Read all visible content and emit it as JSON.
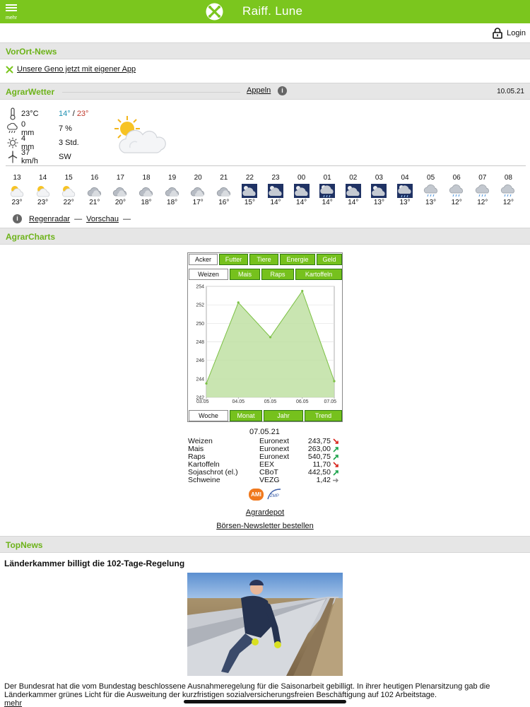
{
  "header": {
    "menu_label": "mehr",
    "app_title": "Raiff. Lune"
  },
  "login": {
    "label": "Login"
  },
  "sections": {
    "vorort": "VorOrt-News",
    "agrarwetter": "AgrarWetter",
    "agrarcharts": "AgrarCharts",
    "topnews": "TopNews"
  },
  "vorort_news": {
    "link": "Unsere Geno jetzt mit eigener App"
  },
  "weather": {
    "location": "Appeln",
    "date": "10.05.21",
    "temperature": "23°C",
    "min": "14°",
    "slash": " / ",
    "max": "23°",
    "precip_mm": "0 mm",
    "precip_pct": "7 %",
    "sun_mm": "4 mm",
    "sun_hours": "3 Std.",
    "wind_speed": "37 km/h",
    "wind_dir": "SW",
    "forecast": [
      {
        "hour": "13",
        "temp": "23°",
        "icon": "sun-cloud"
      },
      {
        "hour": "14",
        "temp": "23°",
        "icon": "sun-cloud"
      },
      {
        "hour": "15",
        "temp": "22°",
        "icon": "sun-cloud"
      },
      {
        "hour": "16",
        "temp": "21°",
        "icon": "cloud"
      },
      {
        "hour": "17",
        "temp": "20°",
        "icon": "cloud"
      },
      {
        "hour": "18",
        "temp": "18°",
        "icon": "cloud"
      },
      {
        "hour": "19",
        "temp": "18°",
        "icon": "cloud"
      },
      {
        "hour": "20",
        "temp": "17°",
        "icon": "cloud"
      },
      {
        "hour": "21",
        "temp": "16°",
        "icon": "cloud"
      },
      {
        "hour": "22",
        "temp": "15°",
        "icon": "night-cloud"
      },
      {
        "hour": "23",
        "temp": "14°",
        "icon": "night-cloud"
      },
      {
        "hour": "00",
        "temp": "14°",
        "icon": "night-cloud"
      },
      {
        "hour": "01",
        "temp": "14°",
        "icon": "night-rain"
      },
      {
        "hour": "02",
        "temp": "14°",
        "icon": "night-cloud"
      },
      {
        "hour": "03",
        "temp": "13°",
        "icon": "night-cloud"
      },
      {
        "hour": "04",
        "temp": "13°",
        "icon": "night-rain"
      },
      {
        "hour": "05",
        "temp": "13°",
        "icon": "cloud-rain"
      },
      {
        "hour": "06",
        "temp": "12°",
        "icon": "cloud-rain"
      },
      {
        "hour": "07",
        "temp": "12°",
        "icon": "cloud-rain"
      },
      {
        "hour": "08",
        "temp": "12°",
        "icon": "cloud-rain"
      }
    ],
    "links": {
      "radar": "Regenradar",
      "dash1": " — ",
      "preview": "Vorschau",
      "dash2": " —"
    }
  },
  "charts": {
    "tabs_top": [
      "Acker",
      "Futter",
      "Tiere",
      "Energie",
      "Geld"
    ],
    "tabs_sub": [
      "Weizen",
      "Mais",
      "Raps",
      "Kartoffeln"
    ],
    "tabs_range": [
      "Woche",
      "Monat",
      "Jahr",
      "Trend"
    ],
    "active_top": "Acker",
    "active_sub": "Weizen",
    "active_range": "Woche"
  },
  "chart_data": {
    "type": "area",
    "x": [
      "03.05",
      "04.05",
      "05.05",
      "06.05",
      "07.05"
    ],
    "values": [
      243.5,
      252.25,
      248.5,
      253.5,
      243.75
    ],
    "ylim": [
      242,
      254
    ],
    "yticks": [
      "254",
      "252",
      "250",
      "248",
      "246",
      "244",
      "242"
    ],
    "title": "",
    "xlabel": "",
    "ylabel": "",
    "grid": true,
    "color": "#7bc043"
  },
  "quotes": {
    "date": "07.05.21",
    "rows": [
      {
        "name": "Weizen",
        "exchange": "Euronext",
        "value": "243,75",
        "trend": "down"
      },
      {
        "name": "Mais",
        "exchange": "Euronext",
        "value": "263,00",
        "trend": "up"
      },
      {
        "name": "Raps",
        "exchange": "Euronext",
        "value": "540,75",
        "trend": "up"
      },
      {
        "name": "Kartoffeln",
        "exchange": "EEX",
        "value": "11,70",
        "trend": "down"
      },
      {
        "name": "Sojaschrot (el.)",
        "exchange": "CBoT",
        "value": "442,50",
        "trend": "up"
      },
      {
        "name": "Schweine",
        "exchange": "VEZG",
        "value": "1,42",
        "trend": "flat"
      }
    ],
    "logo_ami": "AMI",
    "logo_zmp": "ZMP",
    "agrardepot": "Agrardepot",
    "newsletter": "Börsen-Newsletter bestellen"
  },
  "topnews": {
    "headline": "Länderkammer billigt die 102-Tage-Regelung",
    "text": "Der Bundesrat hat die vom Bundestag beschlossene Ausnahmeregelung für die Saisonarbeit gebilligt. In ihrer heutigen Plenarsitzung gab die Länderkammer grünes Licht für die Ausweitung der kurzfristigen sozialversicherungsfreien Beschäftigung auf 102 Arbeitstage.",
    "more": "mehr"
  },
  "colors": {
    "brand": "#7bc61e",
    "section_title": "#6db31a",
    "up": "#1aa34a",
    "down": "#d9251d",
    "flat": "#888888"
  }
}
